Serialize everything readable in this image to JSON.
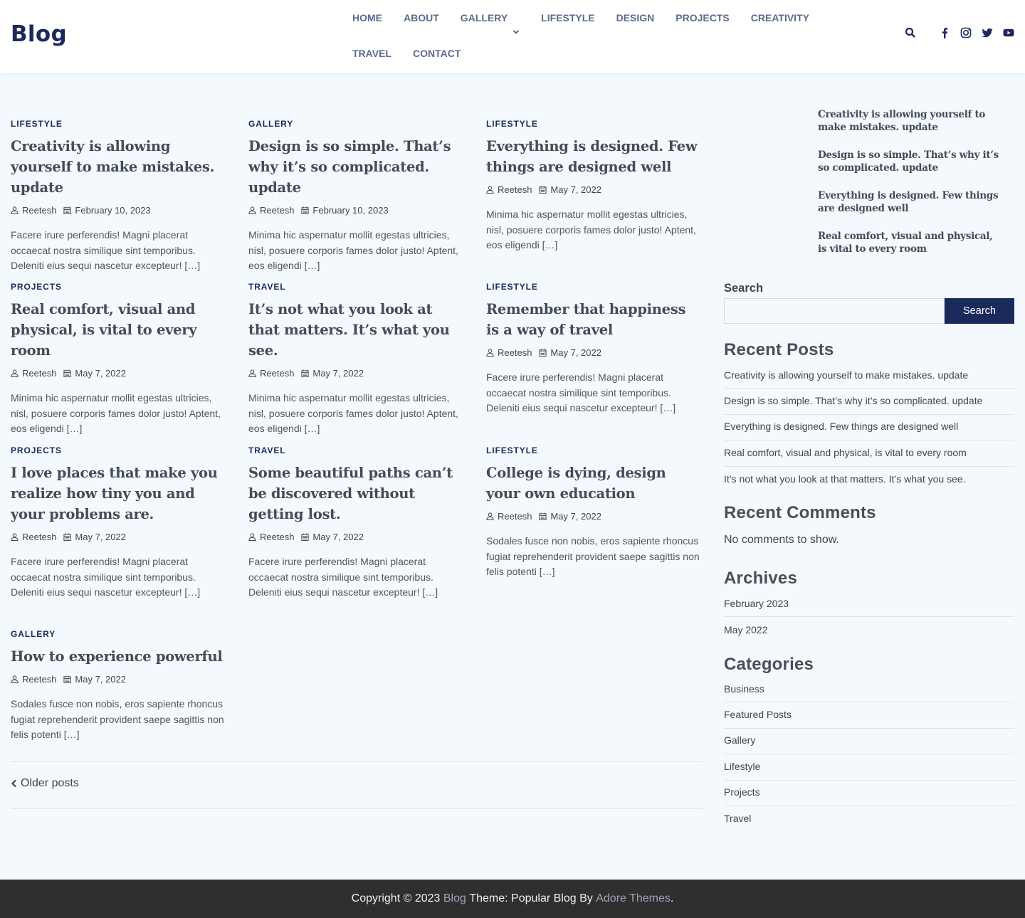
{
  "site": {
    "title": "Blog"
  },
  "nav": {
    "items": [
      "HOME",
      "ABOUT",
      "GALLERY",
      "LIFESTYLE",
      "DESIGN",
      "PROJECTS",
      "CREATIVITY",
      "TRAVEL",
      "CONTACT"
    ]
  },
  "header_icons": [
    "search-icon",
    "facebook-icon",
    "instagram-icon",
    "twitter-icon",
    "youtube-icon"
  ],
  "posts": [
    {
      "category": "LIFESTYLE",
      "title": "Creativity is allowing yourself to make mistakes. update",
      "author": "Reetesh",
      "date": "February 10, 2023",
      "excerpt": "Facere irure perferendis! Magni placerat occaecat nostra similique sint temporibus. Deleniti eius sequi nascetur excepteur! […]"
    },
    {
      "category": "GALLERY",
      "title": "Design is so simple. That’s why it’s so complicated. update",
      "author": "Reetesh",
      "date": "February 10, 2023",
      "excerpt": "Minima hic aspernatur mollit egestas ultricies, nisl, posuere corporis fames dolor justo! Aptent, eos eligendi […]"
    },
    {
      "category": "LIFESTYLE",
      "title": "Everything is designed. Few things are designed well",
      "author": "Reetesh",
      "date": "May 7, 2022",
      "excerpt": "Minima hic aspernatur mollit egestas ultricies, nisl, posuere corporis fames dolor justo! Aptent, eos eligendi […]"
    },
    {
      "category": "PROJECTS",
      "title": "Real comfort, visual and physical, is vital to every room",
      "author": "Reetesh",
      "date": "May 7, 2022",
      "excerpt": "Minima hic aspernatur mollit egestas ultricies, nisl, posuere corporis fames dolor justo! Aptent, eos eligendi […]"
    },
    {
      "category": "TRAVEL",
      "title": "It’s not what you look at that matters. It’s what you see.",
      "author": "Reetesh",
      "date": "May 7, 2022",
      "excerpt": "Minima hic aspernatur mollit egestas ultricies, nisl, posuere corporis fames dolor justo! Aptent, eos eligendi […]"
    },
    {
      "category": "LIFESTYLE",
      "title": "Remember that happiness is a way of travel",
      "author": "Reetesh",
      "date": "May 7, 2022",
      "excerpt": "Facere irure perferendis! Magni placerat occaecat nostra similique sint temporibus. Deleniti eius sequi nascetur excepteur! […]"
    },
    {
      "category": "PROJECTS",
      "title": "I love places that make you realize how tiny you and your problems are.",
      "author": "Reetesh",
      "date": "May 7, 2022",
      "excerpt": "Facere irure perferendis! Magni placerat occaecat nostra similique sint temporibus. Deleniti eius sequi nascetur excepteur! […]"
    },
    {
      "category": "TRAVEL",
      "title": "Some beautiful paths can’t be discovered without getting lost.",
      "author": "Reetesh",
      "date": "May 7, 2022",
      "excerpt": "Facere irure perferendis! Magni placerat occaecat nostra similique sint temporibus. Deleniti eius sequi nascetur excepteur! […]"
    },
    {
      "category": "LIFESTYLE",
      "title": "College is dying, design your own education",
      "author": "Reetesh",
      "date": "May 7, 2022",
      "excerpt": "Sodales fusce non nobis, eros sapiente rhoncus fugiat reprehenderit provident saepe sagittis non felis potenti […]"
    },
    {
      "category": "GALLERY",
      "title": "How to experience powerful",
      "author": "Reetesh",
      "date": "May 7, 2022",
      "excerpt": "Sodales fusce non nobis, eros sapiente rhoncus fugiat reprehenderit provident saepe sagittis non felis potenti […]"
    }
  ],
  "pagination": {
    "older_label": "Older posts"
  },
  "sidebar": {
    "featured": [
      "Creativity is allowing yourself to make mistakes. update",
      "Design is so simple. That’s why it’s so complicated. update",
      "Everything is designed. Few things are designed well",
      "Real comfort, visual and physical, is vital to every room"
    ],
    "search": {
      "label": "Search",
      "button": "Search",
      "value": ""
    },
    "recent_posts": {
      "title": "Recent Posts",
      "items": [
        "Creativity is allowing yourself to make mistakes. update",
        "Design is so simple. That’s why it’s so complicated. update",
        "Everything is designed. Few things are designed well",
        "Real comfort, visual and physical, is vital to every room",
        "It’s not what you look at that matters. It’s what you see."
      ]
    },
    "recent_comments": {
      "title": "Recent Comments",
      "empty": "No comments to show."
    },
    "archives": {
      "title": "Archives",
      "items": [
        "February 2023",
        "May 2022"
      ]
    },
    "categories": {
      "title": "Categories",
      "items": [
        "Business",
        "Featured Posts",
        "Gallery",
        "Lifestyle",
        "Projects",
        "Travel"
      ]
    }
  },
  "footer": {
    "prefix": "Copyright © 2023",
    "site_link": "Blog",
    "middle": "Theme: Popular Blog By",
    "theme_link": "Adore Themes",
    "suffix": "."
  },
  "colors": {
    "brand": "#1b2a5c",
    "background": "#f3f9fd",
    "footer": "#2f2f2f"
  }
}
